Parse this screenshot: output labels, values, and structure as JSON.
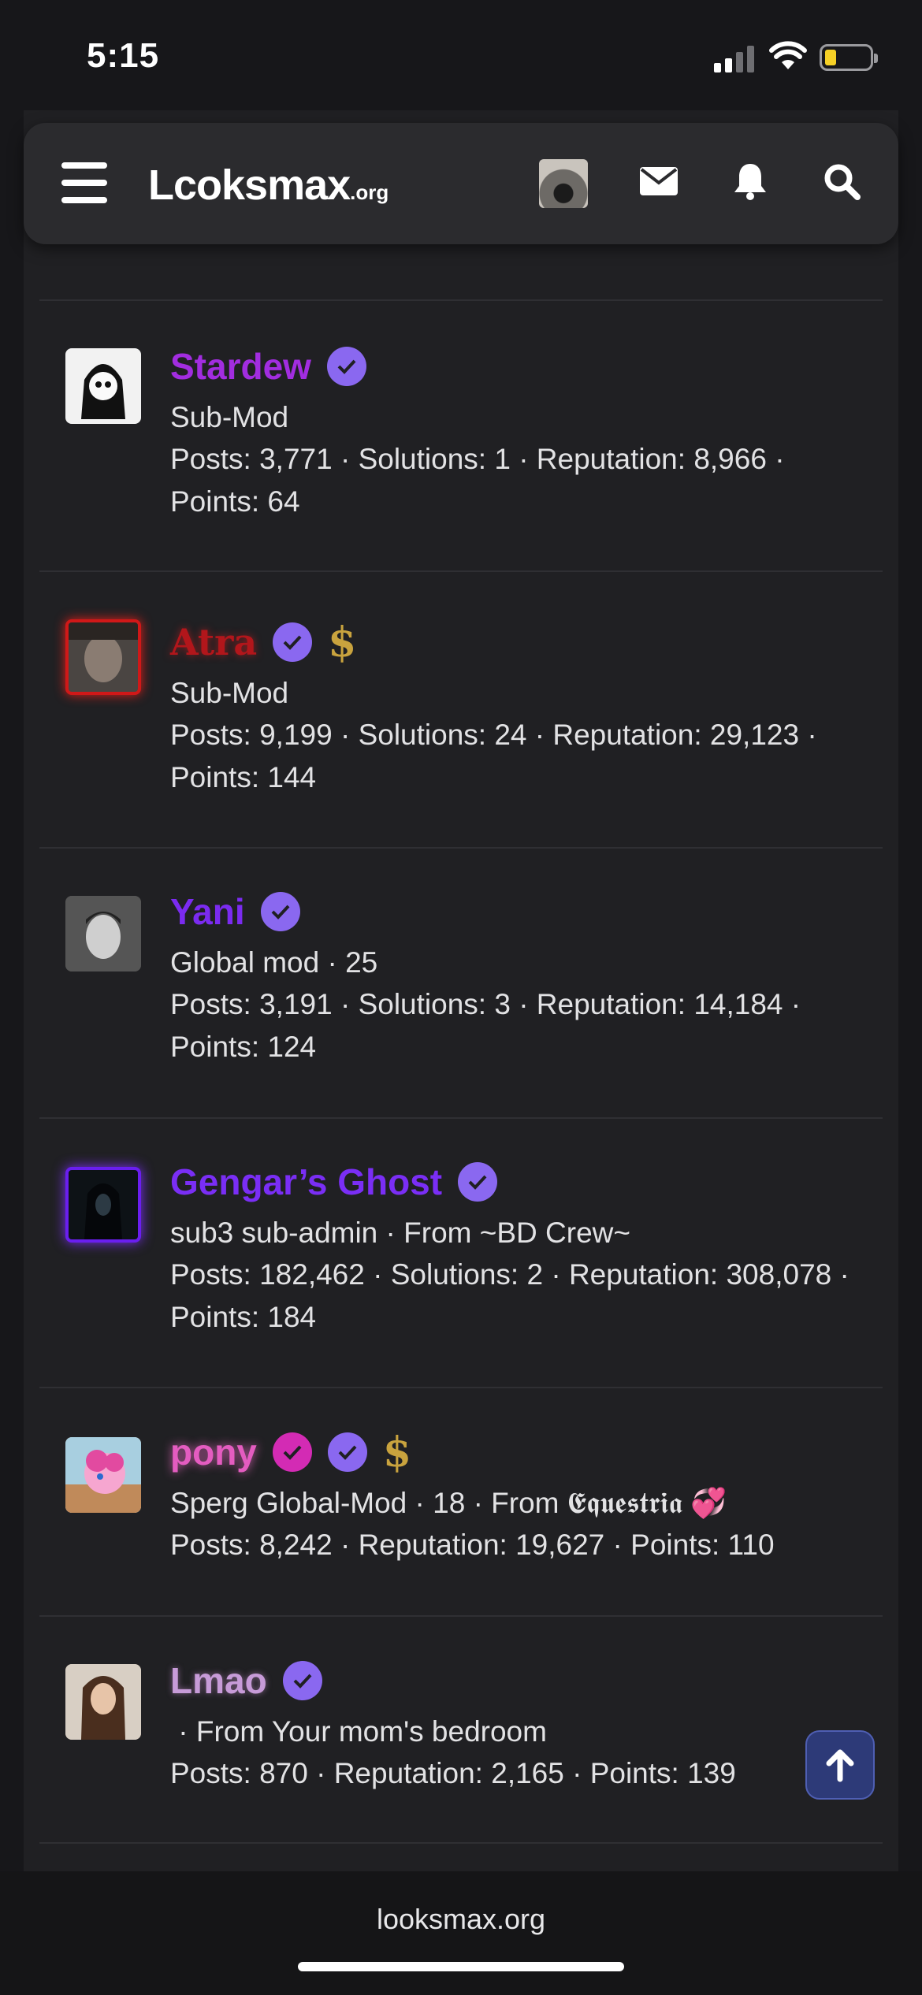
{
  "status_bar": {
    "time": "5:15"
  },
  "navbar": {
    "logo_main": "Lcoksmax",
    "logo_tld": ".org"
  },
  "members": [
    {
      "name": "Stardew",
      "name_color": "#a22de0",
      "title": "Sub-Mod",
      "stats": "Posts: 3,771 · Solutions: 1 · Reputation: 8,966 · Points: 64",
      "badges": [
        "verified-icon"
      ]
    },
    {
      "name": "Atra",
      "name_color": "#b2161b",
      "title": "Sub-Mod",
      "stats": "Posts: 9,199 · Solutions: 24 · Reputation: 29,123 · Points: 144",
      "badges": [
        "verified-icon",
        "dollar-icon"
      ]
    },
    {
      "name": "Yani",
      "name_color": "#7b2bf0",
      "title": "Global mod · 25",
      "stats": "Posts: 3,191 · Solutions: 3 · Reputation: 14,184 · Points: 124",
      "badges": [
        "verified-icon"
      ]
    },
    {
      "name": "Gengar’s Ghost",
      "name_color": "#7a2ef5",
      "title": "sub3 sub-admin · From ~BD Crew~",
      "stats": "Posts: 182,462 · Solutions: 2 · Reputation: 308,078 · Points: 184",
      "badges": [
        "verified-icon"
      ]
    },
    {
      "name": "pony",
      "name_color": "#e45cc0",
      "title_prefix": "Sperg Global-Mod · 18 · From ",
      "title_place": "𝕰𝖖𝖚𝖊𝖘𝖙𝖗𝖎𝖆",
      "title_emoji": "💞",
      "stats": "Posts: 8,242 · Reputation: 19,627 · Points: 110",
      "badges": [
        "pink-verified-icon",
        "verified-icon",
        "dollar-icon"
      ]
    },
    {
      "name": "Lmao",
      "name_color": "#c79bd8",
      "title": " · From Your mom's bedroom",
      "stats": "Posts: 870 · Reputation: 2,165 · Points: 139",
      "badges": [
        "verified-icon"
      ]
    }
  ],
  "footer": {
    "url": "looksmax.org"
  },
  "colors": {
    "verified": "#8a68f0",
    "pink_badge": "#d32bb4",
    "dollar": "#c9a33e",
    "scroll_button": "#2d3a78"
  }
}
